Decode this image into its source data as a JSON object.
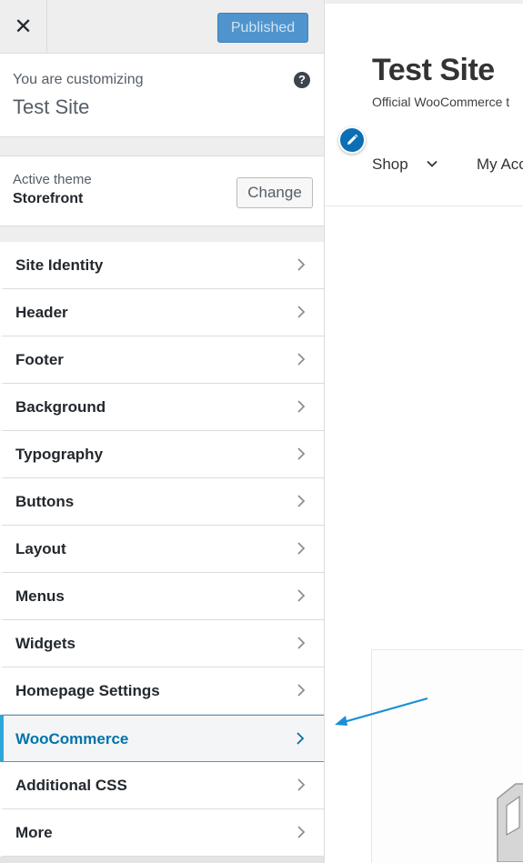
{
  "topbar": {
    "close_icon": "close-icon",
    "publish_label": "Published"
  },
  "customizing": {
    "label": "You are customizing",
    "site_name": "Test Site",
    "help_icon": "help-icon",
    "help_glyph": "?"
  },
  "theme": {
    "label": "Active theme",
    "name": "Storefront",
    "change_label": "Change"
  },
  "sections": [
    {
      "label": "Site Identity"
    },
    {
      "label": "Header"
    },
    {
      "label": "Footer"
    },
    {
      "label": "Background"
    },
    {
      "label": "Typography"
    },
    {
      "label": "Buttons"
    },
    {
      "label": "Layout"
    },
    {
      "label": "Menus"
    },
    {
      "label": "Widgets"
    },
    {
      "label": "Homepage Settings"
    },
    {
      "label": "WooCommerce",
      "highlighted": true
    },
    {
      "label": "Additional CSS"
    },
    {
      "label": "More"
    }
  ],
  "preview": {
    "site_title": "Test Site",
    "tagline": "Official WooCommerce t",
    "edit_icon": "pencil-icon",
    "nav": {
      "shop": "Shop",
      "account": "My Acc"
    }
  },
  "colors": {
    "accent": "#0073aa",
    "highlight_border": "#2ea6d8",
    "publish_bg": "#4f94cd",
    "sidebar_bg": "#eeeeee"
  }
}
